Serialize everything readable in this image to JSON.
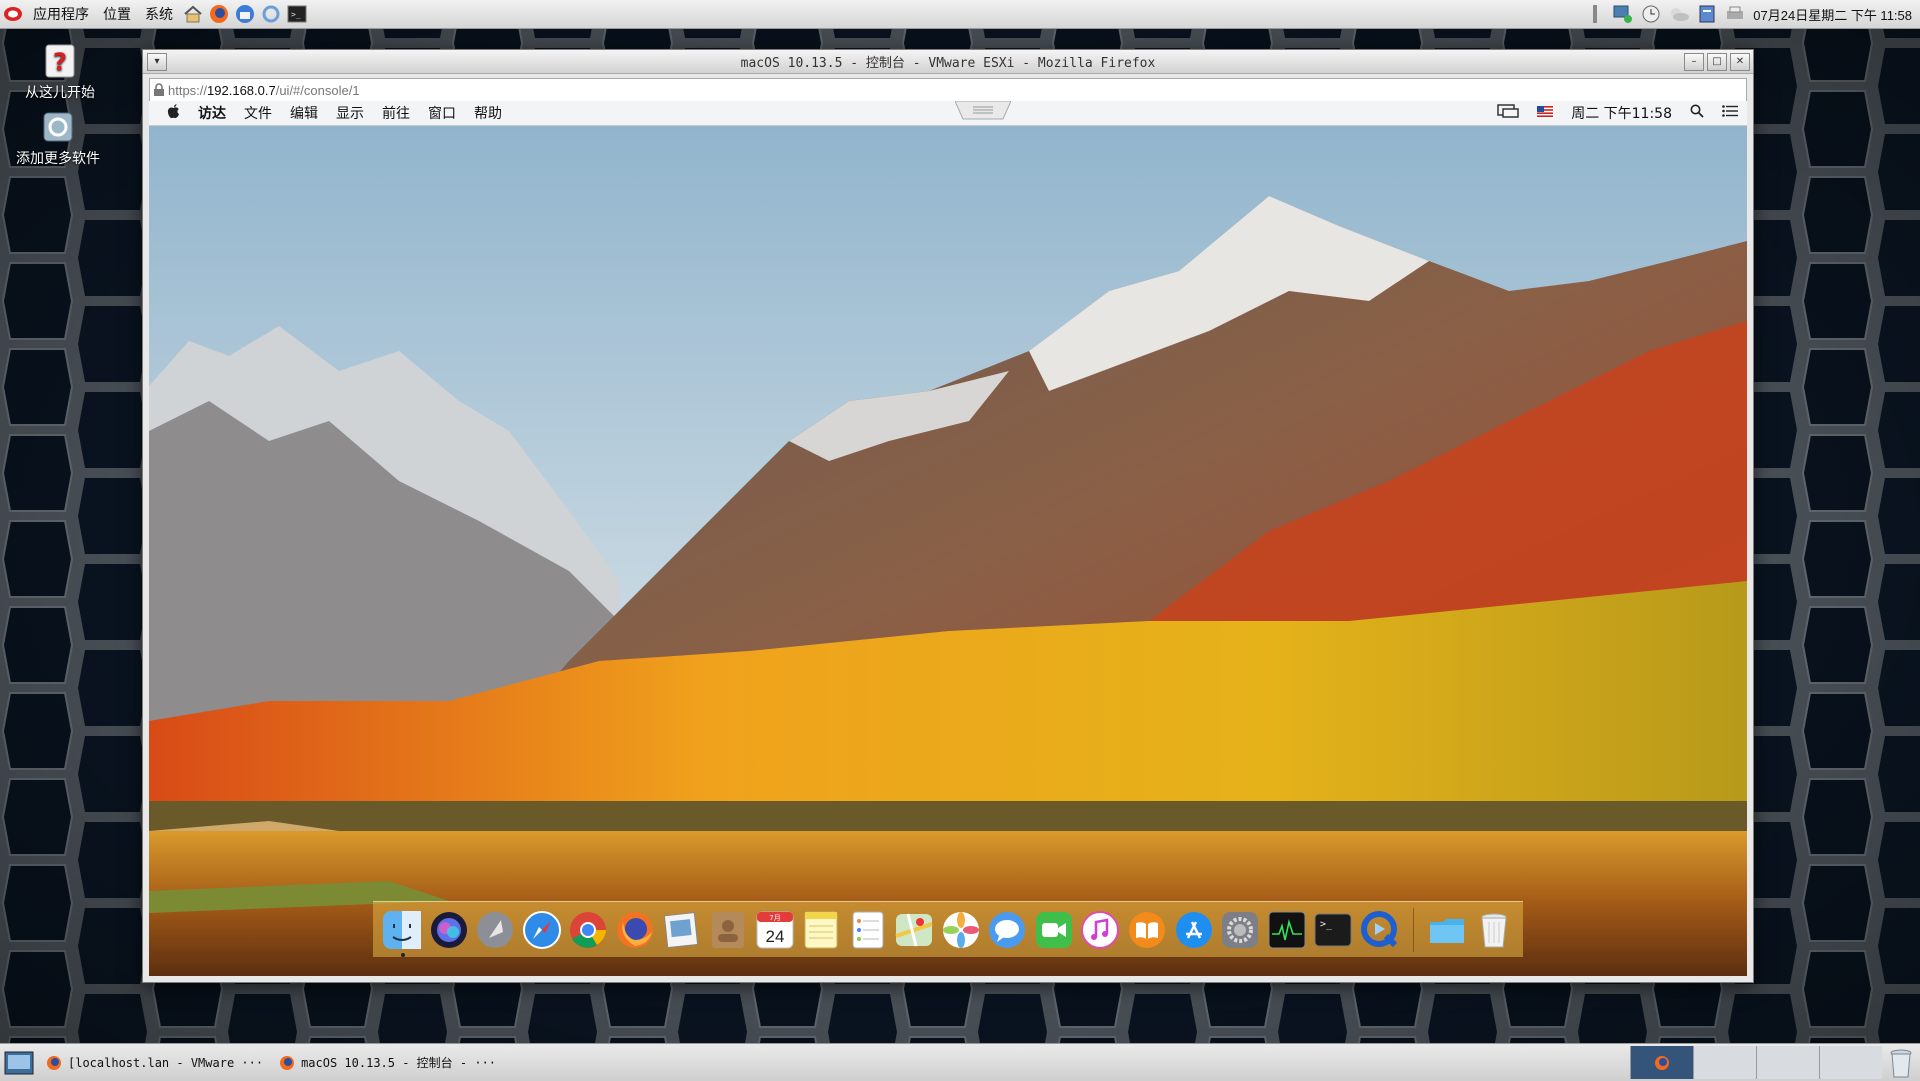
{
  "top_panel": {
    "menus": [
      "应用程序",
      "位置",
      "系统"
    ],
    "clock": "07月24日星期二 下午 11:58"
  },
  "desktop_icons": [
    {
      "label": "从这儿开始",
      "icon": "help-icon"
    },
    {
      "label": "添加更多软件",
      "icon": "add-software-icon"
    }
  ],
  "firefox": {
    "title": "macOS 10.13.5 - 控制台 - VMware ESXi - Mozilla Firefox",
    "url": {
      "prefix": "https://",
      "host": "192.168.0.7",
      "path": "/ui/#/console/1"
    }
  },
  "mac": {
    "menus": [
      "访达",
      "文件",
      "编辑",
      "显示",
      "前往",
      "窗口",
      "帮助"
    ],
    "clock": "周二 下午11:58",
    "dock_apps": [
      "Finder",
      "Siri",
      "Launchpad",
      "Safari",
      "Chrome",
      "Firefox",
      "Preview",
      "Contacts",
      "Calendar",
      "Notes",
      "Reminders",
      "Maps",
      "Photos",
      "Messages",
      "FaceTime",
      "iTunes",
      "iBooks",
      "App Store",
      "System Preferences",
      "Activity Monitor",
      "Terminal",
      "QuickTime Player",
      "Folder",
      "Trash"
    ],
    "calendar_day": "24",
    "calendar_month": "7月"
  },
  "taskbar": {
    "items": [
      "[localhost.lan - VMware ···",
      "macOS 10.13.5 - 控制台 - ···"
    ]
  },
  "colors": {
    "panel": "#dcdcdc",
    "mac_menubar": "#f6f6f6",
    "dock": "#e1b446"
  }
}
